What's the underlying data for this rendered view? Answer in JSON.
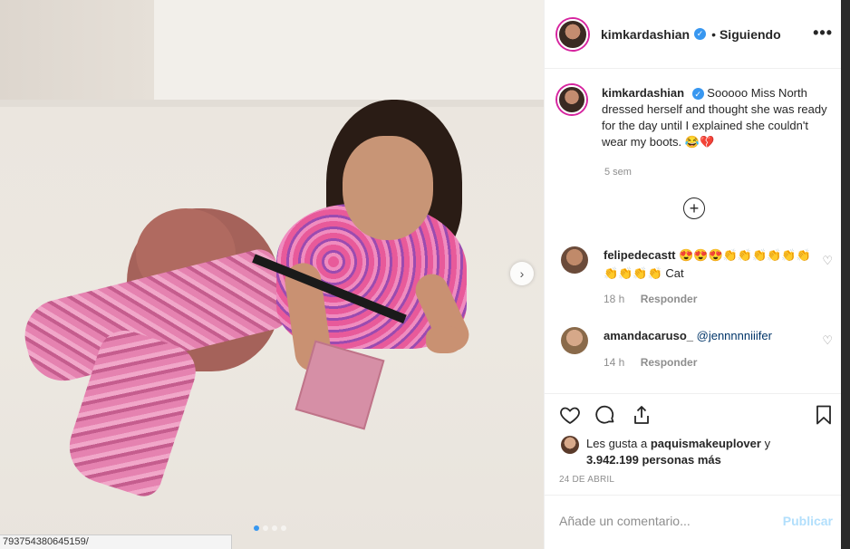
{
  "photo": {
    "dots_count": 4,
    "active_dot": 0,
    "status_url": "793754380645159/"
  },
  "header": {
    "username": "kimkardashian",
    "separator": "•",
    "follow_label": "Siguiendo",
    "more_icon": "more-dots-icon"
  },
  "caption": {
    "username": "kimkardashian",
    "text": "Sooooo Miss North dressed herself and thought she was ready for the day until I explained she couldn't wear my boots. 😂💔",
    "time": "5 sem"
  },
  "comments": [
    {
      "username": "felipedecastt",
      "text": "😍😍😍👏👏👏👏👏👏👏👏👏👏 Cat",
      "time": "18 h",
      "reply_label": "Responder"
    },
    {
      "username": "amandacaruso_",
      "mention": "@jennnnniiifer",
      "time": "14 h",
      "reply_label": "Responder"
    }
  ],
  "likes": {
    "prefix": "Les gusta a",
    "user": "paquismakeuplover",
    "conj": "y",
    "count_text": "3.942.199 personas más"
  },
  "date": "24 DE ABRIL",
  "comment_box": {
    "placeholder": "Añade un comentario...",
    "publish_label": "Publicar"
  },
  "colors": {
    "accent": "#3897f0",
    "publish_disabled": "#b2dffc",
    "text_primary": "#262626",
    "text_secondary": "#8e8e8e"
  }
}
